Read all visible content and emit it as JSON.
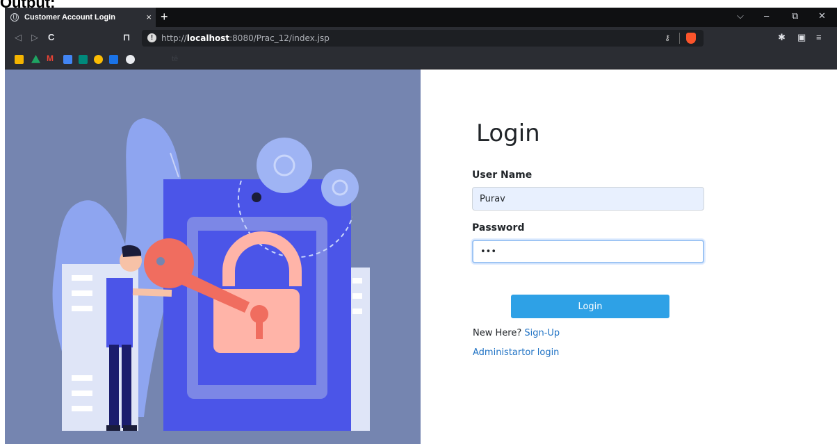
{
  "outer_label": "Output:",
  "browser": {
    "tab": {
      "title": "Customer Account Login",
      "close": "×"
    },
    "new_tab": "+",
    "window_controls": {
      "dropdown": "⌵",
      "minimize": "–",
      "restore": "⧉",
      "close": "✕"
    },
    "nav": {
      "back": "◁",
      "forward": "▷",
      "reload": "C",
      "bookmark": "⊓"
    },
    "address": {
      "prefix": "http://",
      "host": "localhost",
      "rest": ":8080/Prac_12/index.jsp"
    },
    "bookmarks_text": "tê",
    "icons": [
      "image-icon",
      "drive-icon",
      "gmail-icon",
      "sheets-icon",
      "meet-icon",
      "cloud-icon",
      "calendar-icon",
      "globe-icon"
    ]
  },
  "colors": {
    "illustration_bg": "#7585b0",
    "login_button": "#2ea1e6",
    "link": "#1f72c4"
  },
  "login": {
    "title": "Login",
    "username_label": "User Name",
    "username_value": "Purav",
    "password_label": "Password",
    "password_value": "•••",
    "button": "Login",
    "new_here": "New Here?",
    "signup_link": "Sign-Up",
    "admin_link": "Administartor login"
  }
}
